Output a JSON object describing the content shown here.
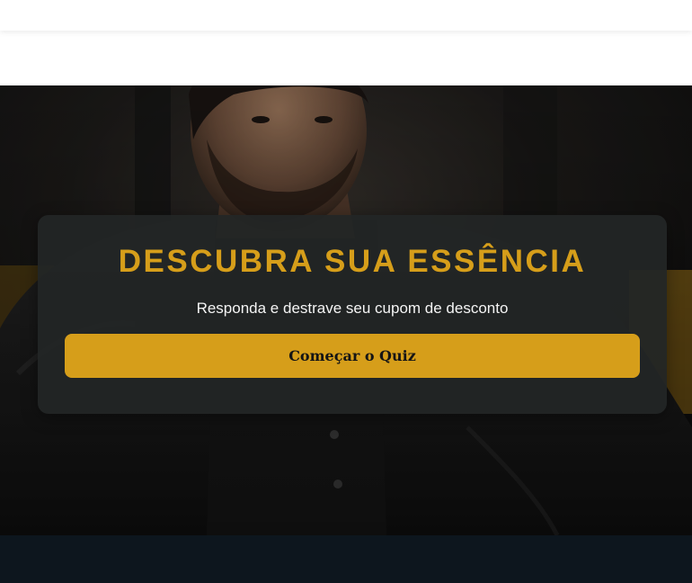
{
  "hero": {
    "title": "DESCUBRA SUA ESSÊNCIA",
    "subtitle": "Responda e destrave seu cupom de desconto",
    "cta_label": "Começar o Quiz"
  },
  "colors": {
    "accent": "#d69e1a",
    "card_background": "#222626",
    "footer_background": "#0d161e",
    "subtitle_text": "#f4f4f4",
    "button_text": "#151515"
  }
}
